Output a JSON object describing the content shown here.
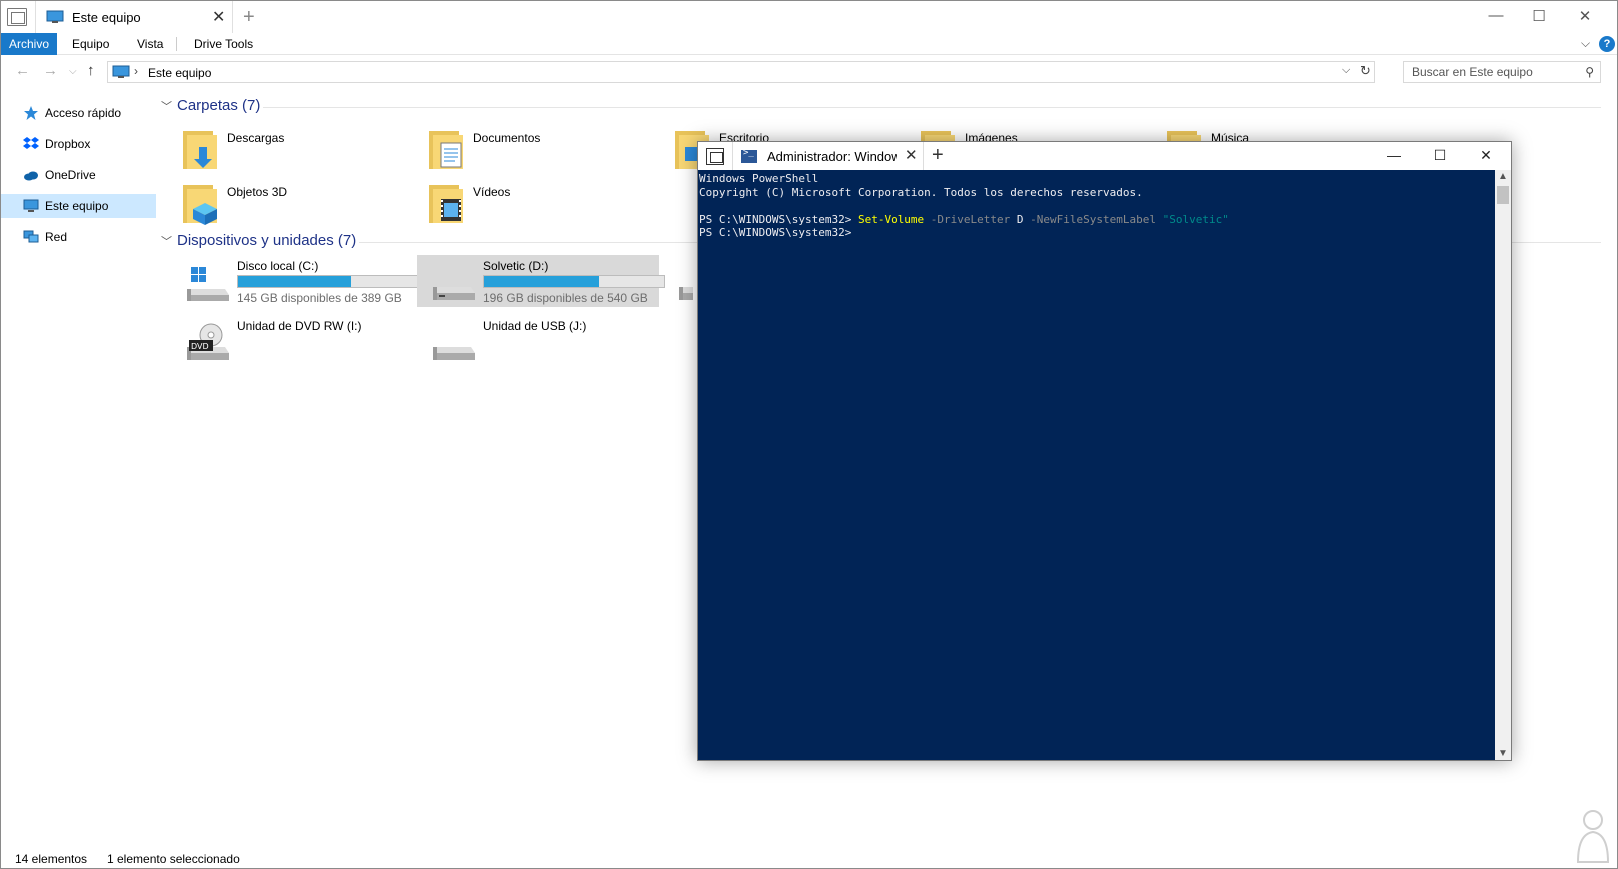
{
  "explorer": {
    "tab_title": "Este equipo",
    "ribbon_tabs": [
      {
        "label": "Archivo"
      },
      {
        "label": "Equipo"
      },
      {
        "label": "Vista"
      },
      {
        "label": "Drive Tools"
      }
    ],
    "address": "Este equipo",
    "search_placeholder": "Buscar en Este equipo",
    "sidebar": [
      {
        "label": "Acceso rápido",
        "icon": "star-icon"
      },
      {
        "label": "Dropbox",
        "icon": "dropbox-icon"
      },
      {
        "label": "OneDrive",
        "icon": "cloud-icon"
      },
      {
        "label": "Este equipo",
        "icon": "computer-icon"
      },
      {
        "label": "Red",
        "icon": "network-icon"
      }
    ],
    "folders_group": "Carpetas (7)",
    "folders": [
      {
        "label": "Descargas"
      },
      {
        "label": "Documentos"
      },
      {
        "label": "Escritorio"
      },
      {
        "label": "Imágenes"
      },
      {
        "label": "Música"
      },
      {
        "label": "Objetos 3D"
      },
      {
        "label": "Vídeos"
      }
    ],
    "devices_group": "Dispositivos y unidades (7)",
    "drives": [
      {
        "label": "Disco local (C:)",
        "free_text": "145 GB disponibles de 389 GB",
        "used_fraction": 0.627
      },
      {
        "label": "Solvetic (D:)",
        "free_text": "196 GB disponibles de 540 GB",
        "used_fraction": 0.637
      },
      {
        "label": "Unidad de DVD RW (I:)"
      },
      {
        "label": "Unidad de USB (J:)"
      }
    ],
    "status": {
      "count": "14 elementos",
      "selected": "1 elemento seleccionado"
    },
    "accent_color": "#1979ca"
  },
  "powershell": {
    "tab_title": "Administrador: Windows PowerShell",
    "lines": {
      "l1": "Windows PowerShell",
      "l2": "Copyright (C) Microsoft Corporation. Todos los derechos reservados.",
      "prompt": "PS C:\\WINDOWS\\system32> ",
      "cmd": "Set-Volume",
      "p1": " -DriveLetter",
      "v1": " D",
      "p2": " -NewFileSystemLabel",
      "v2": " \"Solvetic\""
    },
    "background_color": "#012456"
  }
}
